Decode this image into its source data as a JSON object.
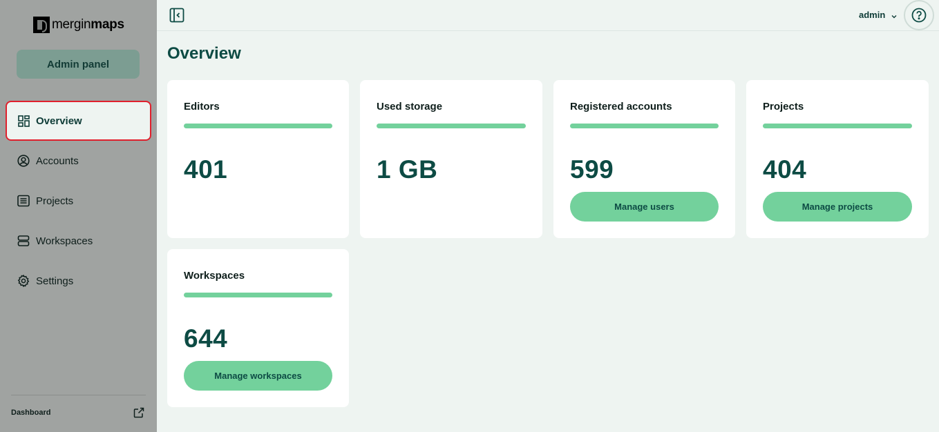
{
  "sidebar": {
    "logo": {
      "text_regular": "mergin",
      "text_bold": "maps"
    },
    "admin_panel_label": "Admin panel",
    "items": [
      {
        "label": "Overview",
        "icon": "grid-icon",
        "active": true
      },
      {
        "label": "Accounts",
        "icon": "user-circle-icon",
        "active": false
      },
      {
        "label": "Projects",
        "icon": "list-icon",
        "active": false
      },
      {
        "label": "Workspaces",
        "icon": "server-icon",
        "active": false
      },
      {
        "label": "Settings",
        "icon": "gear-icon",
        "active": false
      }
    ],
    "footer": {
      "dashboard_label": "Dashboard",
      "icon": "external-link-icon"
    }
  },
  "topbar": {
    "collapse_icon": "sidebar-collapse-icon",
    "user_label": "admin",
    "user_icon": "chevron-down-icon",
    "help_icon": "help-circle-icon"
  },
  "main": {
    "title": "Overview",
    "cards": [
      {
        "title": "Editors",
        "value": "401",
        "button": null
      },
      {
        "title": "Used storage",
        "value": "1 GB",
        "button": null
      },
      {
        "title": "Registered accounts",
        "value": "599",
        "button": "Manage users"
      },
      {
        "title": "Projects",
        "value": "404",
        "button": "Manage projects"
      },
      {
        "title": "Workspaces",
        "value": "644",
        "button": "Manage workspaces"
      }
    ]
  },
  "colors": {
    "accent": "#73d19c",
    "primary_text": "#0d4b44",
    "sidebar_bg": "#a0a3a1",
    "page_bg": "#eef4f1",
    "active_outline": "#e0202c"
  }
}
